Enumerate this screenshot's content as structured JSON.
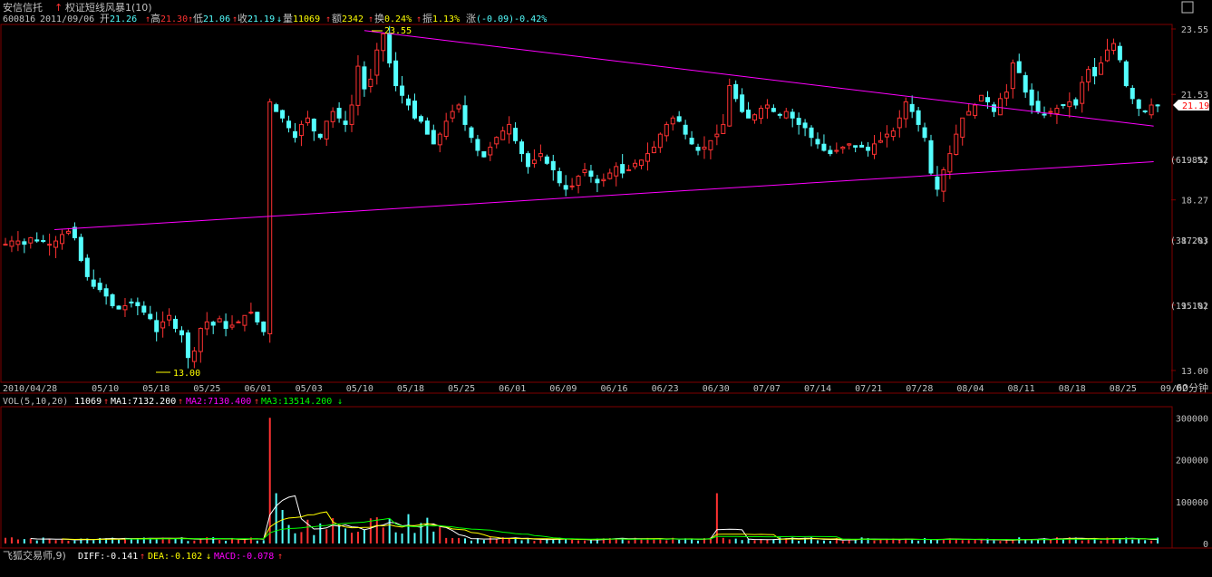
{
  "header": {
    "stock_name": "安信信托",
    "indicator_name": "权证短线风暴1(10)",
    "code": "600816",
    "date": "2011/09/06",
    "open_label": "开",
    "open": "21.26",
    "high_label": "高",
    "high": "21.30",
    "low_label": "低",
    "low": "21.06",
    "close_label": "收",
    "close": "21.19",
    "vol_label": "量",
    "vol": "11069",
    "amount_label": "额",
    "amount": "2342",
    "turnover_label": "换",
    "turnover": "0.24%",
    "amplitude_label": "振",
    "amplitude": "1.13%",
    "change_label": "涨",
    "change": "(-0.09)-0.42%"
  },
  "colors": {
    "up": "#ff3232",
    "down": "#54ffff",
    "trendline": "#ff00ff",
    "grid": "#800000",
    "axis_text": "#c0c0c0",
    "ma1": "#ffffff",
    "ma2": "#ffff00",
    "ma3": "#ff00ff",
    "ma4": "#00ff00"
  },
  "chart_data": [
    {
      "type": "candlestick",
      "timeframe": "60分钟",
      "x_labels": [
        "2010/04/28",
        "05/10",
        "05/18",
        "05/25",
        "06/01",
        "05/03",
        "05/10",
        "05/18",
        "05/25",
        "06/01",
        "06/09",
        "06/16",
        "06/23",
        "06/30",
        "07/07",
        "07/14",
        "07/21",
        "07/28",
        "08/04",
        "08/11",
        "08/18",
        "08/25",
        "09/02"
      ],
      "y_ticks": [
        "23.55",
        "21.53",
        "19.52",
        "18.27",
        "17.03",
        "15.02",
        "13.00"
      ],
      "fib_labels": [
        "(61.8%)",
        "(38.2%)",
        "(19.1%)"
      ],
      "annotations": {
        "high": "23.55",
        "low": "13.00",
        "current": "21.19"
      },
      "ylim": [
        13.0,
        23.55
      ],
      "trend_lines": [
        {
          "from": [
            0.045,
            17.35
          ],
          "to": [
            0.985,
            19.45
          ]
        },
        {
          "from": [
            0.31,
            23.5
          ],
          "to": [
            0.985,
            20.55
          ]
        }
      ],
      "close_series": [
        16.9,
        17.0,
        17.0,
        16.9,
        17.1,
        17.0,
        17.0,
        16.9,
        17.0,
        17.2,
        17.3,
        17.1,
        16.4,
        15.9,
        15.6,
        15.5,
        15.3,
        15.0,
        14.9,
        15.0,
        15.1,
        15.0,
        14.8,
        14.6,
        14.2,
        14.5,
        14.7,
        14.3,
        14.1,
        13.4,
        13.6,
        14.3,
        14.5,
        14.4,
        14.6,
        14.3,
        14.4,
        14.5,
        14.7,
        14.8,
        14.5,
        14.2,
        21.3,
        21.0,
        20.8,
        20.5,
        20.2,
        20.6,
        20.8,
        20.4,
        20.2,
        20.7,
        21.0,
        20.8,
        20.6,
        21.2,
        22.4,
        21.7,
        22.0,
        22.9,
        23.4,
        22.5,
        21.8,
        21.5,
        21.2,
        20.8,
        20.7,
        20.3,
        20.0,
        20.3,
        20.7,
        21.0,
        21.2,
        20.6,
        20.2,
        19.8,
        19.6,
        19.9,
        20.2,
        20.4,
        20.6,
        20.1,
        19.7,
        19.3,
        19.5,
        19.7,
        19.4,
        19.2,
        18.8,
        18.6,
        18.7,
        19.0,
        19.2,
        19.0,
        18.8,
        18.9,
        19.1,
        19.3,
        19.1,
        19.2,
        19.4,
        19.5,
        19.7,
        19.9,
        20.3,
        20.6,
        20.8,
        20.7,
        20.3,
        20.0,
        19.8,
        19.9,
        20.1,
        20.3,
        20.6,
        21.8,
        21.4,
        21.0,
        20.8,
        20.9,
        21.1,
        21.2,
        21.0,
        20.9,
        21.0,
        20.8,
        20.6,
        20.5,
        20.2,
        20.0,
        19.8,
        19.7,
        19.8,
        19.9,
        20.0,
        19.9,
        19.9,
        19.8,
        20.0,
        20.1,
        20.3,
        20.4,
        20.8,
        21.3,
        21.0,
        20.6,
        20.2,
        19.1,
        18.6,
        19.2,
        19.7,
        20.3,
        20.8,
        21.0,
        21.2,
        21.5,
        21.3,
        21.0,
        21.4,
        21.6,
        22.5,
        22.2,
        21.6,
        21.2,
        21.0,
        20.9,
        21.0,
        21.1,
        21.2,
        21.3,
        21.2,
        21.9,
        22.3,
        22.1,
        22.5,
        22.9,
        23.1,
        22.6,
        21.8,
        21.4,
        21.1,
        21.0,
        21.2,
        21.19
      ]
    },
    {
      "type": "bar",
      "title": "VOL(5,10,20)",
      "legend": [
        {
          "label": "11069",
          "arrow": "↑"
        },
        {
          "label": "MA1:7132.200",
          "arrow": "↑"
        },
        {
          "label": "MA2:7130.400",
          "arrow": "↑"
        },
        {
          "label": "MA3:13514.200",
          "arrow": "↓"
        }
      ],
      "y_ticks": [
        "300000",
        "200000",
        "100000",
        "0"
      ],
      "ylim": [
        0,
        320000
      ]
    },
    {
      "type": "line",
      "title": "飞狐交易师,9)",
      "legend": [
        {
          "label": "DIFF:-0.141",
          "arrow": "↑"
        },
        {
          "label": "DEA:-0.102",
          "arrow": "↓"
        },
        {
          "label": "MACD:-0.078",
          "arrow": "↑"
        }
      ]
    }
  ]
}
